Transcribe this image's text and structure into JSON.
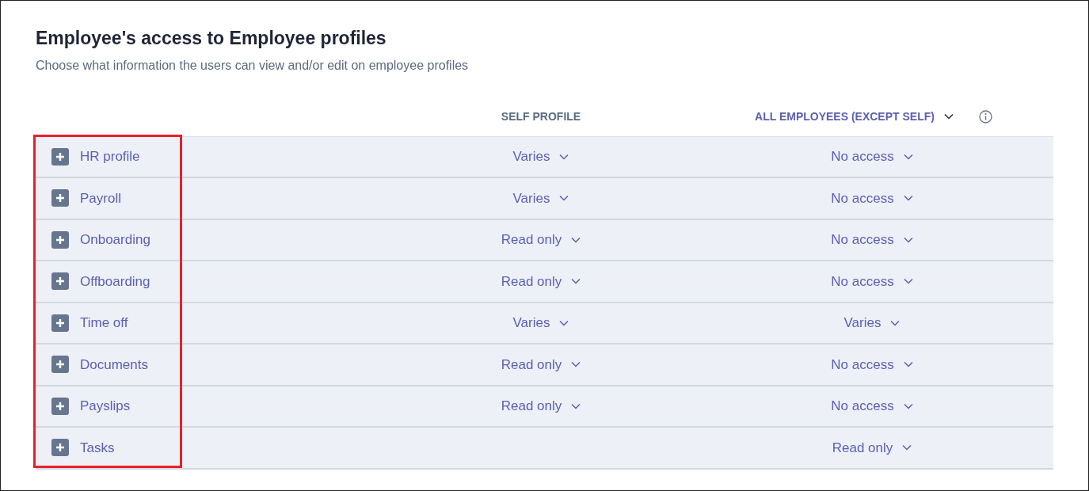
{
  "title": "Employee's access to Employee profiles",
  "subtitle": "Choose what information the users can view and/or edit on employee profiles",
  "columns": [
    {
      "label": "SELF PROFILE",
      "kind": "plain"
    },
    {
      "label": "ALL EMPLOYEES (EXCEPT SELF)",
      "kind": "dropdown"
    }
  ],
  "rows": [
    {
      "name": "HR profile",
      "expanded": false,
      "self": "Varies",
      "all": "No access"
    },
    {
      "name": "Payroll",
      "expanded": false,
      "self": "Varies",
      "all": "No access"
    },
    {
      "name": "Onboarding",
      "expanded": false,
      "self": "Read only",
      "all": "No access"
    },
    {
      "name": "Offboarding",
      "expanded": false,
      "self": "Read only",
      "all": "No access"
    },
    {
      "name": "Time off",
      "expanded": false,
      "self": "Varies",
      "all": "Varies"
    },
    {
      "name": "Documents",
      "expanded": false,
      "self": "Read only",
      "all": "No access"
    },
    {
      "name": "Payslips",
      "expanded": false,
      "self": "Read only",
      "all": "No access"
    },
    {
      "name": "Tasks",
      "expanded": false,
      "all": "Read only"
    }
  ]
}
